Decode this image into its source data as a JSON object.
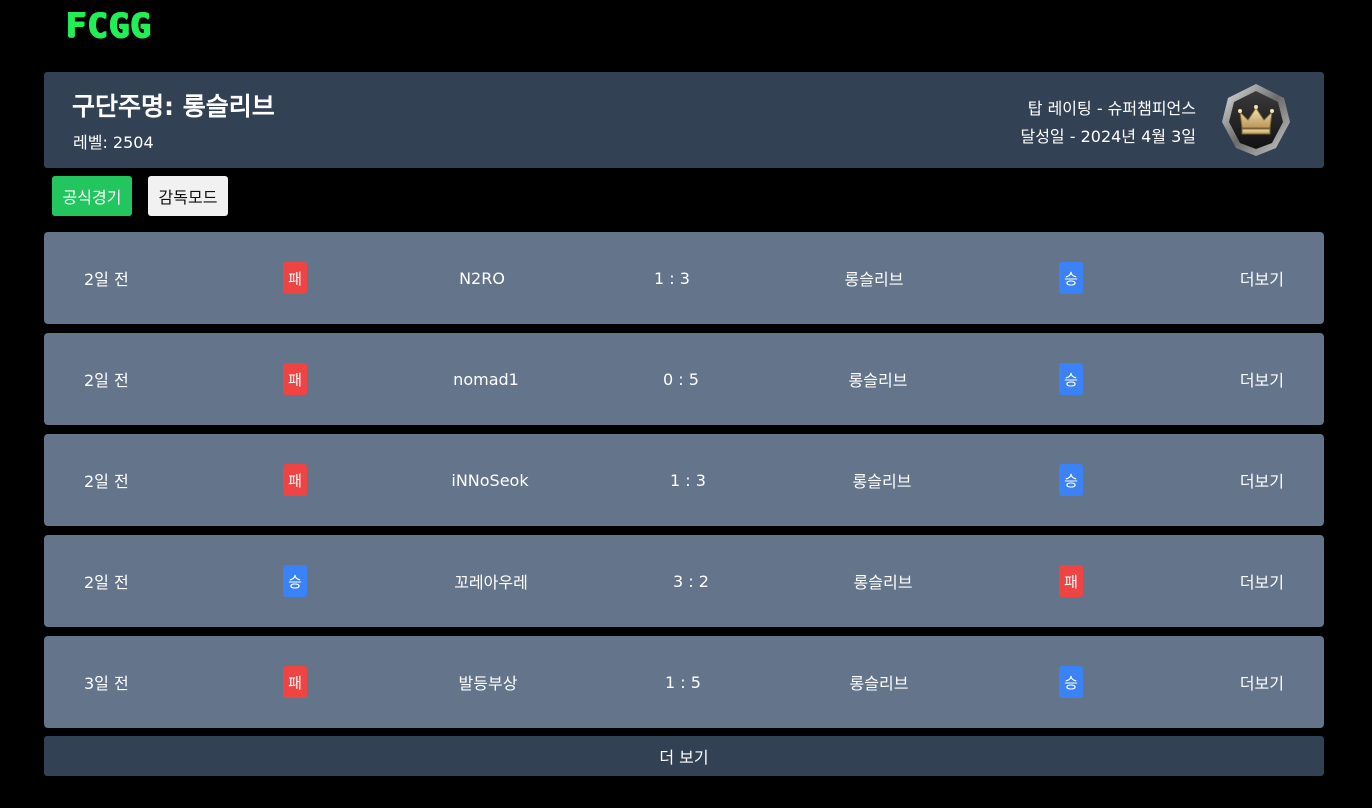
{
  "logo": "FCGG",
  "header": {
    "club_name": "구단주명: 롱슬리브",
    "level": "레벨: 2504",
    "top_rating": "탑 레이팅 - 슈퍼챔피언스",
    "achieved_date": "달성일 - 2024년 4월 3일",
    "badge_icon": "crown-rank-badge-icon"
  },
  "tabs": {
    "official": "공식경기",
    "manager": "감독모드"
  },
  "colors": {
    "logo": "#22ee55",
    "win": "#3b82f6",
    "loss": "#ef4444",
    "row_bg": "#64748b",
    "header_bg": "#334155",
    "active_tab": "#22c55e"
  },
  "matches": [
    {
      "time": "2일 전",
      "opponent_result": "패",
      "opponent": "N2RO",
      "score": "1 : 3",
      "me": "롱슬리브",
      "my_result": "승",
      "more": "더보기"
    },
    {
      "time": "2일 전",
      "opponent_result": "패",
      "opponent": "nomad1",
      "score": "0 : 5",
      "me": "롱슬리브",
      "my_result": "승",
      "more": "더보기"
    },
    {
      "time": "2일 전",
      "opponent_result": "패",
      "opponent": "iNNoSeok",
      "score": "1 : 3",
      "me": "롱슬리브",
      "my_result": "승",
      "more": "더보기"
    },
    {
      "time": "2일 전",
      "opponent_result": "승",
      "opponent": "꼬레아우레",
      "score": "3 : 2",
      "me": "롱슬리브",
      "my_result": "패",
      "more": "더보기"
    },
    {
      "time": "3일 전",
      "opponent_result": "패",
      "opponent": "발등부상",
      "score": "1 : 5",
      "me": "롱슬리브",
      "my_result": "승",
      "more": "더보기"
    }
  ],
  "load_more": "더 보기"
}
